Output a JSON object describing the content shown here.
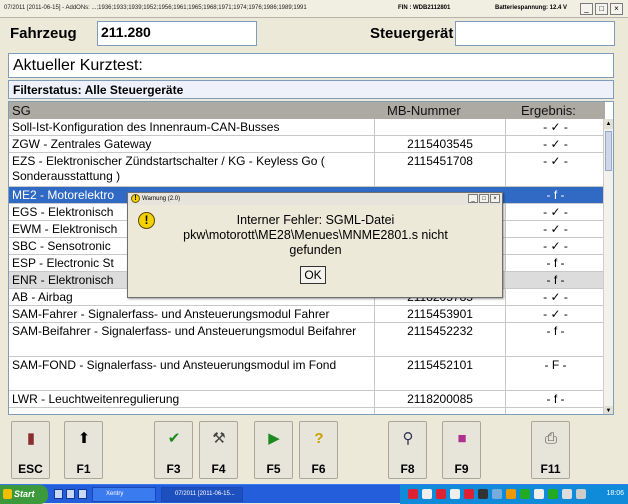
{
  "window": {
    "title": "07/2011 [2011-06-15]  - AddONs: ...;1936;1933;1939;1952;1956;1961;1965;1968;1971;1974;1976;1986;1989;1991",
    "fin": "FIN : WDB2112801",
    "battery": "Batteriespannung: 12.4 V",
    "controls": [
      "_",
      "□",
      "×"
    ]
  },
  "header": {
    "fahrzeug_label": "Fahrzeug",
    "fahrzeug_value": "211.280",
    "steuergeraet_label": "Steuergerät",
    "steuergeraet_value": ""
  },
  "kurztest": "Aktueller Kurztest:",
  "filter_status": "Filterstatus: Alle Steuergeräte",
  "table": {
    "headers": {
      "sg": "SG",
      "mb": "MB-Nummer",
      "ergebnis": "Ergebnis:"
    },
    "rows": [
      {
        "sg": "Soll-Ist-Konfiguration des Innenraum-CAN-Busses",
        "mb": "",
        "ergebnis": "- ✓ -"
      },
      {
        "sg": "ZGW - Zentrales Gateway",
        "mb": "2115403545",
        "ergebnis": "- ✓ -"
      },
      {
        "sg": "EZS - Elektronischer Zündstartschalter / KG - Keyless Go ( Sonderausstattung )",
        "mb": "2115451708",
        "ergebnis": "- ✓ -"
      },
      {
        "sg": "ME2 - Motorelektro",
        "mb": "",
        "ergebnis": "- f -"
      },
      {
        "sg": "EGS - Elektronisch",
        "mb": "",
        "ergebnis": "- ✓ -"
      },
      {
        "sg": "EWM - Elektronisch",
        "mb": "",
        "ergebnis": "- ✓ -"
      },
      {
        "sg": "SBC - Sensotronic",
        "mb": "",
        "ergebnis": "- ✓ -"
      },
      {
        "sg": "ESP - Electronic St",
        "mb": "",
        "ergebnis": "- f -"
      },
      {
        "sg": "ENR - Elektronisch",
        "mb": "",
        "ergebnis": "- f -"
      },
      {
        "sg": "AB - Airbag",
        "mb": "2118205785",
        "ergebnis": "- ✓ -"
      },
      {
        "sg": "SAM-Fahrer - Signalerfass- und Ansteuerungsmodul Fahrer",
        "mb": "2115453901",
        "ergebnis": "- ✓ -"
      },
      {
        "sg": "SAM-Beifahrer - Signalerfass- und Ansteuerungsmodul Beifahrer",
        "mb": "2115452232",
        "ergebnis": "- f -"
      },
      {
        "sg": "SAM-FOND - Signalerfass- und Ansteuerungsmodul im Fond",
        "mb": "2115452101",
        "ergebnis": "- F -"
      },
      {
        "sg": "LWR - Leuchtweitenregulierung",
        "mb": "2118200085",
        "ergebnis": "- f -"
      }
    ]
  },
  "dialog": {
    "title": "Warnung  (2.0)",
    "message": "Interner Fehler: SGML-Datei pkw\\motorott\\ME28\\Menues\\MNME2801.s nicht gefunden",
    "ok_label": "OK"
  },
  "toolbar": {
    "buttons": [
      {
        "label": "ESC",
        "icon": "exit-door-icon"
      },
      {
        "label": "F1",
        "icon": "arrow-up-icon"
      },
      {
        "label": "F3",
        "icon": "checkmark-icon"
      },
      {
        "label": "F4",
        "icon": "tools-icon"
      },
      {
        "label": "F5",
        "icon": "start-icon"
      },
      {
        "label": "F6",
        "icon": "help-icon"
      },
      {
        "label": "F8",
        "icon": "magnifier-icon"
      },
      {
        "label": "F9",
        "icon": "colors-icon"
      },
      {
        "label": "F11",
        "icon": "printer-icon"
      }
    ]
  },
  "taskbar": {
    "start_label": "Start",
    "tasks": [
      "Xentry",
      "07/2011 [2011-06-15..."
    ],
    "clock": "18:06"
  }
}
